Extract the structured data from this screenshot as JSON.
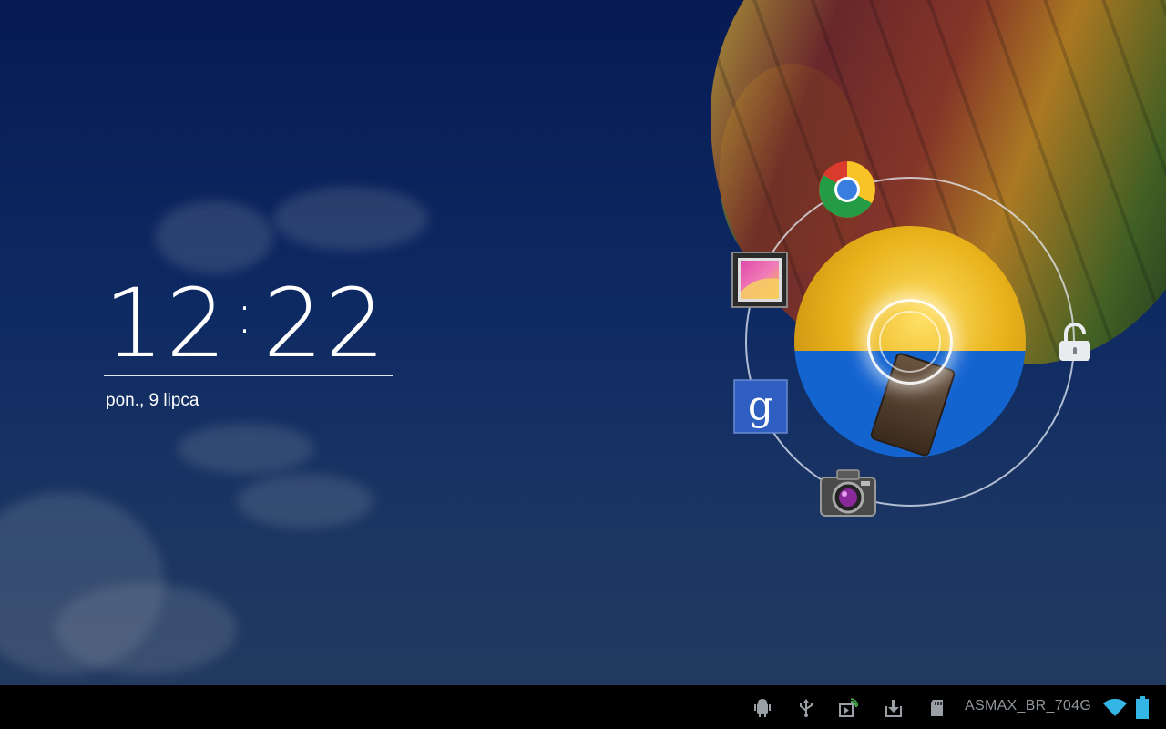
{
  "lockscreen": {
    "clock": {
      "hours": "12",
      "separator": ":",
      "minutes": "22",
      "date": "pon., 9 lipca"
    },
    "glowpad_targets": {
      "chrome": "chrome-icon",
      "gallery": "gallery-icon",
      "google": "google-search-icon",
      "camera": "camera-icon",
      "unlock": "unlock-icon"
    }
  },
  "statusbar": {
    "network_name": "ASMAX_BR_704G",
    "icons": [
      "android-debug-icon",
      "usb-icon",
      "media-cast-icon",
      "download-icon",
      "sd-card-icon",
      "wifi-icon",
      "battery-icon"
    ],
    "wifi_color": "#33b5e5",
    "battery_color": "#33b5e5"
  }
}
